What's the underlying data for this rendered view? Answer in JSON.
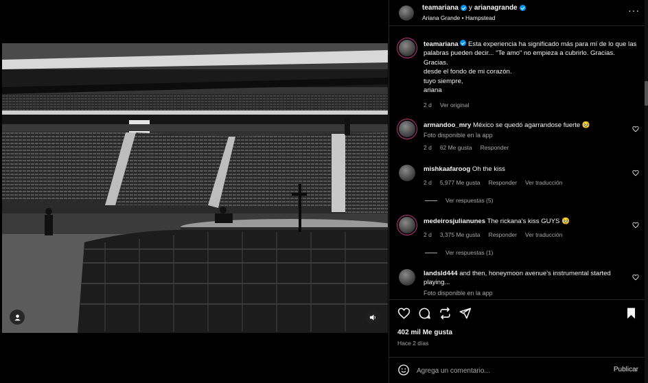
{
  "post": {
    "author": "teamariana",
    "collab_joiner": "y",
    "collaborator": "arianagrande",
    "audio": "Ariana Grande",
    "location": "Hampstead"
  },
  "caption": {
    "user": "teamariana",
    "text": "Esta experiencia ha significado más para mí de lo que las palabras pueden decir... \"Te amo\" no empieza a cubrirlo. Gracias. Gracias.\ndesde el fondo de mi corazón.\ntuyo siempre,\nariana",
    "time": "2 d",
    "see_original": "Ver original"
  },
  "comments": [
    {
      "user": "armandoo_mry",
      "text": "México se quedó agarrandose fuerte",
      "emoji": "🥹",
      "sub": "Foto disponible en la app",
      "time": "2 d",
      "likes": "62 Me gusta",
      "reply": "Responder",
      "translate": ""
    },
    {
      "user": "mishkaafaroog",
      "text": "Oh the kiss",
      "emoji": "",
      "sub": "",
      "time": "2 d",
      "likes": "5,977 Me gusta",
      "reply": "Responder",
      "translate": "Ver traducción",
      "replies": "Ver respuestas (5)"
    },
    {
      "user": "medeirosjulianunes",
      "text": "The rickana's kiss GUYS",
      "emoji": "🥹",
      "sub": "",
      "time": "2 d",
      "likes": "3,375 Me gusta",
      "reply": "Responder",
      "translate": "Ver traducción",
      "replies": "Ver respuestas (1)"
    },
    {
      "user": "landsld444",
      "text": "and then, honeymoon avenue's instrumental started playing...",
      "emoji": "",
      "sub": "Foto disponible en la app",
      "time": "",
      "likes": "",
      "reply": "",
      "translate": ""
    }
  ],
  "stats": {
    "likes": "402 mil Me gusta",
    "ago": "Hace 2 días"
  },
  "compose": {
    "placeholder": "Agrega un comentario...",
    "post_label": "Publicar"
  },
  "icons": {
    "more": "more-horizontal-icon",
    "like": "heart-icon",
    "comment": "comment-icon",
    "repost": "repost-icon",
    "share": "send-icon",
    "save": "bookmark-icon",
    "emoji": "emoji-icon",
    "tag": "user-tag-icon",
    "audio": "speaker-icon"
  },
  "colors": {
    "verified": "#0095f6",
    "background": "#000000",
    "muted_text": "#a8a8a8"
  }
}
